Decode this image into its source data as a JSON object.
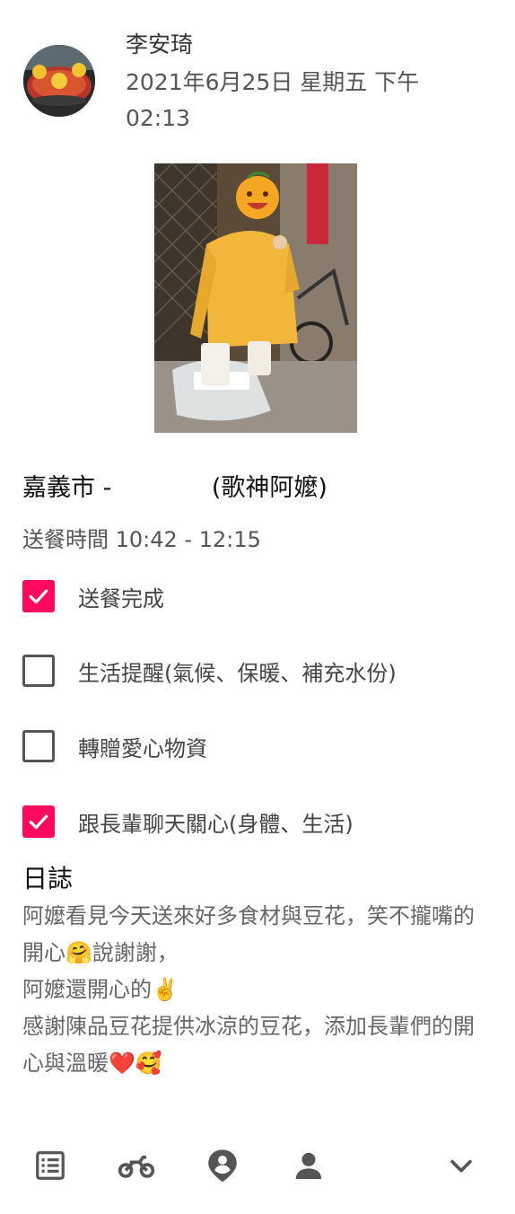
{
  "post": {
    "author": "李安琦",
    "timestamp": "2021年6月25日 星期五 下午 02:13"
  },
  "delivery": {
    "place": "嘉義市 -             (歌神阿嬤)",
    "time_range": "送餐時間 10:42 - 12:15"
  },
  "tasks": [
    {
      "label": "送餐完成",
      "checked": true
    },
    {
      "label": "生活提醒(氣候、保暖、補充水份)",
      "checked": false
    },
    {
      "label": "轉贈愛心物資",
      "checked": false
    },
    {
      "label": "跟長輩聊天關心(身體、生活)",
      "checked": true
    }
  ],
  "log": {
    "title": "日誌",
    "body": "阿嬤看見今天送來好多食材與豆花，笑不攏嘴的開心🤗說謝謝，\n阿嬤還開心的✌️\n感謝陳品豆花提供冰涼的豆花，添加長輩們的開心與溫暖❤️🥰"
  },
  "nav": [
    {
      "name": "list-icon"
    },
    {
      "name": "motorcycle-icon"
    },
    {
      "name": "location-person-icon"
    },
    {
      "name": "person-icon"
    },
    {
      "name": "chevron-down-icon"
    }
  ],
  "colors": {
    "accent": "#ff0a5f",
    "icon": "#555555"
  }
}
